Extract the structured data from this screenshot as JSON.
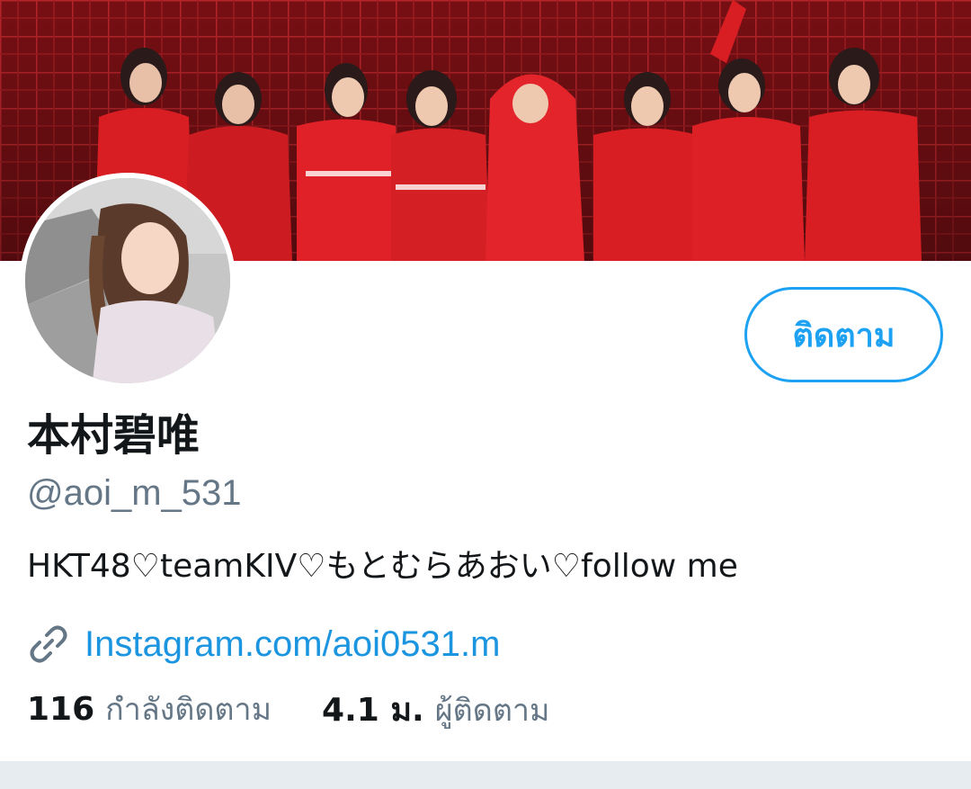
{
  "profile": {
    "display_name": "本村碧唯",
    "handle": "@aoi_m_531",
    "bio": "HKT48♡teamKIV♡もとむらあおい♡follow me",
    "link_text": "Instagram.com/aoi0531.m",
    "follow_label": "ติดตาม"
  },
  "stats": {
    "following_count": "116",
    "following_label": "กำลังติดตาม",
    "followers_count": "4.1 ม.",
    "followers_label": "ผู้ติดตาม"
  },
  "icons": {
    "link": "link-icon"
  },
  "colors": {
    "accent": "#1da1f2",
    "link": "#1b95e0",
    "secondary_text": "#657786",
    "primary_text": "#14171a",
    "banner_red": "#d81e23",
    "divider": "#e6ecf0"
  }
}
